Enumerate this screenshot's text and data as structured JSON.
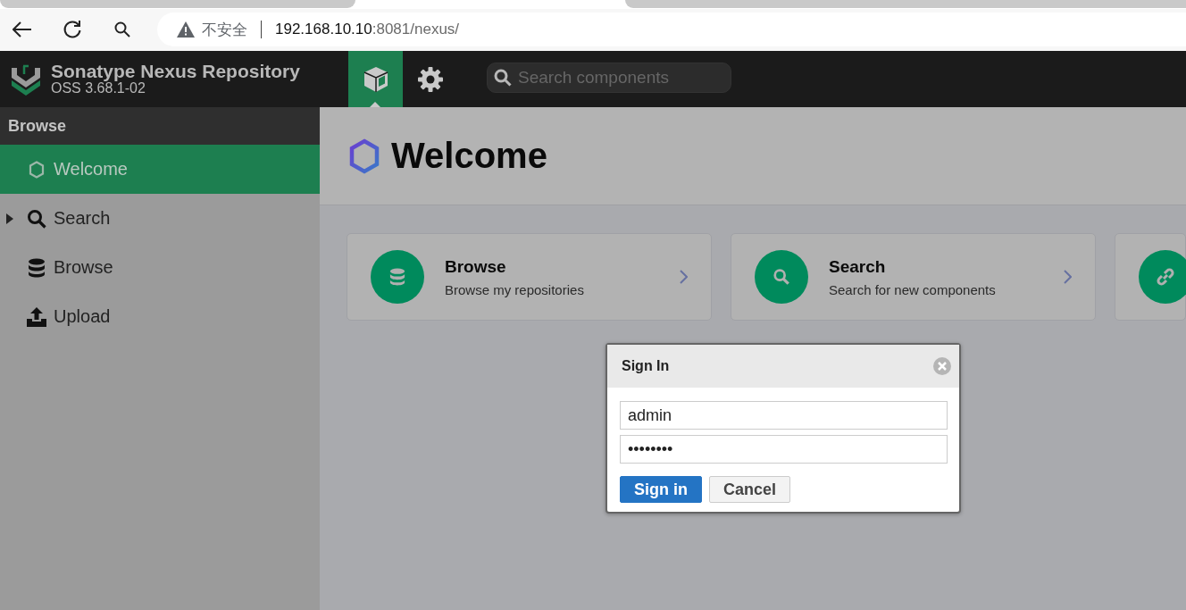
{
  "browser": {
    "security_label": "不安全",
    "url_host": "192.168.10.10",
    "url_rest": ":8081/nexus/"
  },
  "header": {
    "product": "Sonatype Nexus Repository",
    "version": "OSS 3.68.1-02",
    "search": {
      "placeholder": "Search components"
    },
    "nav": [
      {
        "kind": "browse",
        "selected": true
      },
      {
        "kind": "admin",
        "selected": false
      }
    ]
  },
  "sidebar": {
    "title": "Browse",
    "items": [
      {
        "label": "Welcome",
        "kind": "leaf",
        "selected": true
      },
      {
        "label": "Search",
        "kind": "group",
        "selected": false
      },
      {
        "label": "Browse",
        "kind": "leaf",
        "selected": false
      },
      {
        "label": "Upload",
        "kind": "leaf",
        "selected": false
      }
    ]
  },
  "page": {
    "title": "Welcome",
    "cards": [
      {
        "kind": "database",
        "title": "Browse",
        "description": "Browse my repositories"
      },
      {
        "kind": "search",
        "title": "Search",
        "description": "Search for new components"
      },
      {
        "kind": "link"
      }
    ]
  },
  "dialog": {
    "title": "Sign In",
    "username": "admin",
    "password": "••••••••",
    "buttons": [
      {
        "label": "Sign in",
        "primary": true
      },
      {
        "label": "Cancel",
        "primary": false
      }
    ]
  }
}
